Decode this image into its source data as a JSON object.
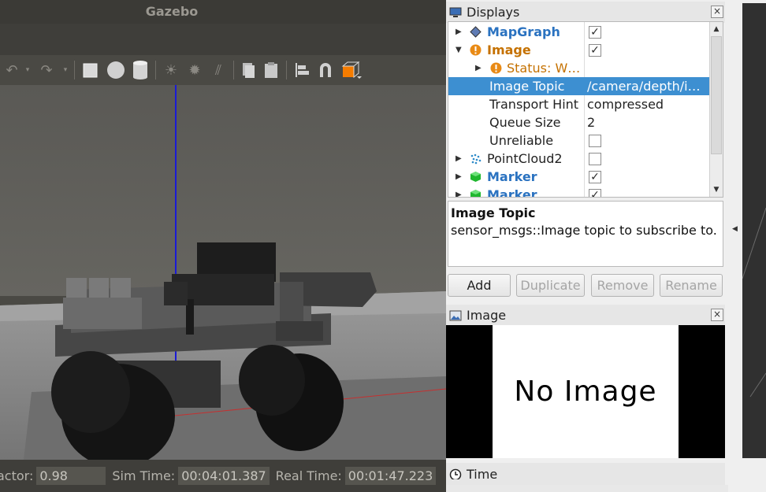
{
  "gazebo": {
    "window_title": "Gazebo",
    "toolbar_icons": [
      "undo-icon",
      "redo-icon",
      "box-icon",
      "sphere-icon",
      "cylinder-icon",
      "sun-icon",
      "point-light-icon",
      "directional-light-icon",
      "copy-icon",
      "paste-icon",
      "align-icon",
      "snap-icon",
      "view-angle-icon"
    ],
    "status": {
      "rtf_label": "actor:",
      "rtf_value": "0.98",
      "sim_time_label": "Sim Time:",
      "sim_time_value": "00:04:01.387",
      "real_time_label": "Real Time:",
      "real_time_value": "00:01:47.223"
    }
  },
  "displays": {
    "title": "Displays",
    "close": "×",
    "rows": [
      {
        "name": "MapGraph",
        "value": "✓"
      },
      {
        "name": "Image",
        "value": "✓"
      },
      {
        "name": "Status: W…",
        "value": ""
      },
      {
        "name": "Image Topic",
        "value": "/camera/depth/i…"
      },
      {
        "name": "Transport Hint",
        "value": "compressed"
      },
      {
        "name": "Queue Size",
        "value": "2"
      },
      {
        "name": "Unreliable",
        "value": ""
      },
      {
        "name": "PointCloud2",
        "value": ""
      },
      {
        "name": "Marker",
        "value": "✓"
      },
      {
        "name": "Marker",
        "value": "✓"
      }
    ],
    "description": {
      "title": "Image Topic",
      "text": "sensor_msgs::Image topic to subscribe to."
    },
    "buttons": {
      "add": "Add",
      "duplicate": "Duplicate",
      "remove": "Remove",
      "rename": "Rename"
    }
  },
  "image_panel": {
    "title": "Image",
    "close": "×",
    "placeholder": "No Image"
  },
  "time_panel": {
    "title": "Time"
  },
  "colors": {
    "selection": "#3d8fd1",
    "display_name_blue": "#2a72c0",
    "warning_orange": "#c57100",
    "gazebo_bg": "#4a4944"
  }
}
